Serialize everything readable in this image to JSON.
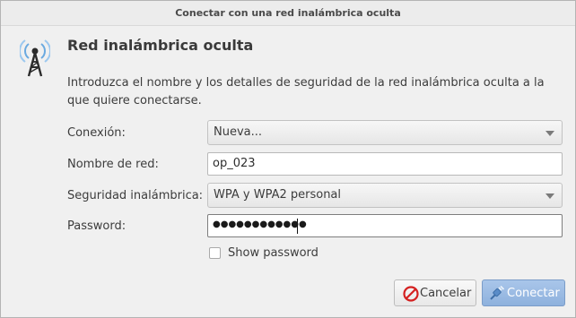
{
  "window": {
    "title": "Conectar con una red inalámbrica oculta"
  },
  "dialog": {
    "icon": "wifi-tower-icon",
    "heading": "Red inalámbrica oculta",
    "description": "Introduzca el nombre y los detalles de seguridad de la red inalámbrica oculta a la que quiere conectarse."
  },
  "form": {
    "connection_label": "Conexión:",
    "connection_value": "Nueva...",
    "network_name_label": "Nombre de red:",
    "network_name_value": "op_023",
    "security_label": "Seguridad inalámbrica:",
    "security_value": "WPA y WPA2 personal",
    "password_label": "Password:",
    "password_masked": "●●●●●●●●●●●●",
    "show_password_label": "Show password",
    "show_password_checked": false
  },
  "buttons": {
    "cancel_label": "Cancelar",
    "cancel_icon": "cancel-icon",
    "connect_label": "Conectar",
    "connect_icon": "connect-plug-icon"
  },
  "colors": {
    "window_bg": "#f0f0f0",
    "connect_button": "#9dbde5",
    "cancel_icon_red": "#d42020"
  }
}
